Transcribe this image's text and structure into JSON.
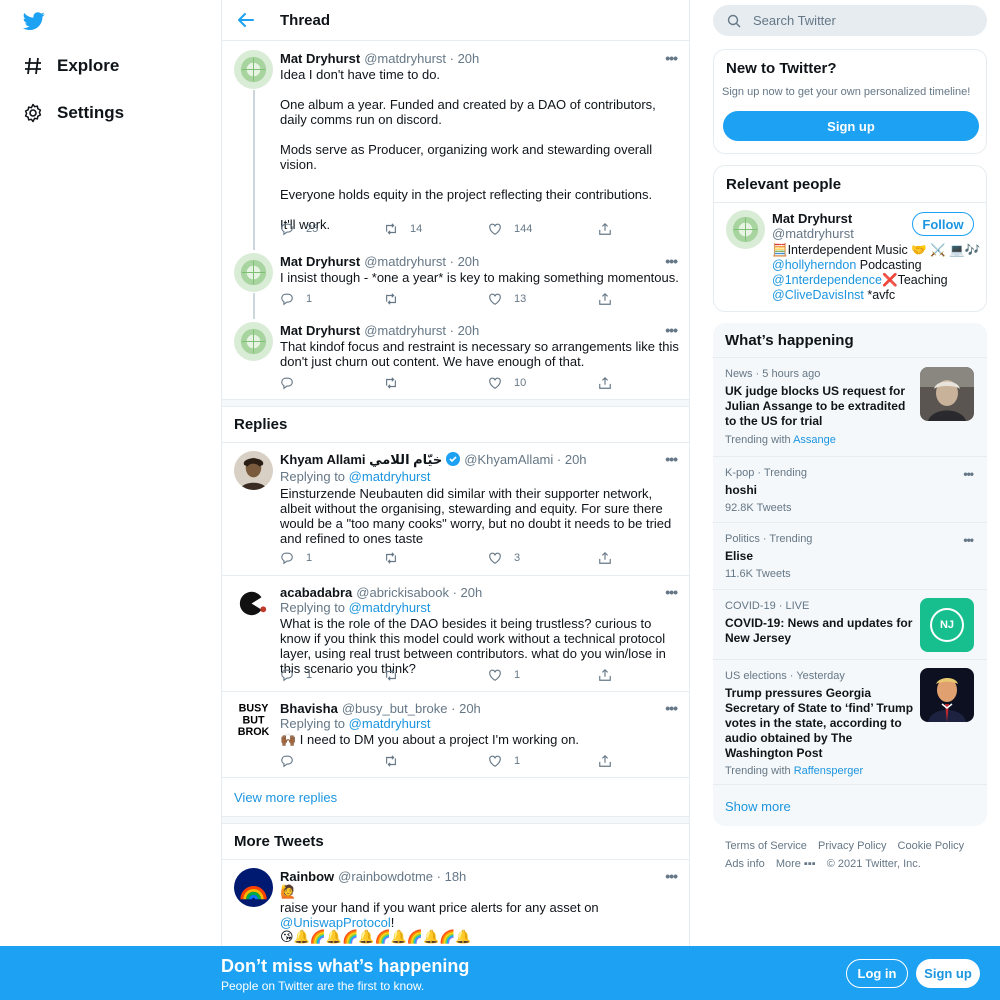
{
  "nav": {
    "explore": "Explore",
    "settings": "Settings"
  },
  "header": {
    "title": "Thread"
  },
  "thread": [
    {
      "name": "Mat Dryhurst",
      "handle": "@matdryhurst",
      "time": "· 20h",
      "paragraphs": [
        "Idea I don't have time to do.",
        "One album a year. Funded and created by a DAO of contributors, daily comms run on discord.",
        "Mods serve as Producer, organizing work and stewarding overall vision.",
        "Everyone holds equity in the project reflecting their contributions.",
        "It'll work."
      ],
      "replies": "25",
      "retweets": "14",
      "likes": "144"
    },
    {
      "name": "Mat Dryhurst",
      "handle": "@matdryhurst",
      "time": "· 20h",
      "text": "I insist though - *one a year* is key to making something momentous.",
      "replies": "1",
      "retweets": "",
      "likes": "13"
    },
    {
      "name": "Mat Dryhurst",
      "handle": "@matdryhurst",
      "time": "· 20h",
      "text": "That kindof focus and restraint is necessary so arrangements like this don't just churn out content. We have enough of that.",
      "replies": "",
      "retweets": "",
      "likes": "10"
    }
  ],
  "replies_section": {
    "title": "Replies",
    "replying_label": "Replying to",
    "replying_handle": "@matdryhurst",
    "items": [
      {
        "name": "Khyam Allami خيّام اللامي",
        "handle": "@KhyamAllami",
        "time": "· 20h",
        "text": "Einsturzende Neubauten did similar with their supporter network, albeit without the organising, stewarding and equity. For sure there would be a \"too many cooks\" worry, but no doubt it needs to be tried and refined to ones taste",
        "replies": "1",
        "retweets": "",
        "likes": "3"
      },
      {
        "name": "acabadabra",
        "handle": "@abrickisabook",
        "time": "· 20h",
        "text": "What is the role of the DAO besides it being trustless? curious to know if you think this model could work without a technical protocol layer, using real trust between contributors. what do you win/lose in this scenario you think?",
        "replies": "1",
        "retweets": "",
        "likes": "1"
      },
      {
        "name": "Bhavisha",
        "handle": "@busy_but_broke",
        "time": "· 20h",
        "text": "🙌🏾 I need to DM you about a project I'm working on.",
        "replies": "",
        "retweets": "",
        "likes": "1"
      }
    ],
    "view_more": "View more replies"
  },
  "more_tweets": {
    "title": "More Tweets",
    "tweet": {
      "name": "Rainbow",
      "handle": "@rainbowdotme",
      "time": "· 18h",
      "emoji_line": "🙋",
      "text_prefix": "raise your hand if you want price alerts for any asset on ",
      "mention": "@UniswapProtocol",
      "text_suffix": "!",
      "emoji_row": "😘🔔🌈🔔🌈🔔🌈🔔🌈🔔🌈🔔"
    }
  },
  "search": {
    "placeholder": "Search Twitter"
  },
  "new_to_twitter": {
    "title": "New to Twitter?",
    "subtitle": "Sign up now to get your own personalized timeline!",
    "button": "Sign up"
  },
  "relevant_people": {
    "title": "Relevant people",
    "name": "Mat Dryhurst",
    "handle": "@matdryhurst",
    "follow": "Follow",
    "bio_line1": "🧮Interdependent Music 🤝 ⚔️ 💻🎶",
    "bio_mention1": "@hollyherndon",
    "bio_after1": " Podcasting",
    "bio_mention2": "@1nterdependence",
    "bio_after2": "❌Teaching",
    "bio_mention3": "@CliveDavisInst",
    "bio_after3": " *avfc"
  },
  "whats_happening": {
    "title": "What’s happening",
    "trends": [
      {
        "category": "News · 5 hours ago",
        "name": "UK judge blocks US request for Julian Assange to be extradited to the US for trial",
        "sub_prefix": "Trending with ",
        "sub_link": "Assange"
      },
      {
        "category": "K-pop · Trending",
        "name": "hoshi",
        "sub": "92.8K Tweets"
      },
      {
        "category": "Politics · Trending",
        "name": "Elise",
        "sub": "11.6K Tweets"
      },
      {
        "category": "COVID-19 · LIVE",
        "name": "COVID-19: News and updates for New Jersey",
        "thumb_text": "NJ"
      },
      {
        "category": "US elections · Yesterday",
        "name": "Trump pressures Georgia Secretary of State to ‘find’ Trump votes in the state, according to audio obtained by The Washington Post",
        "sub_prefix": "Trending with ",
        "sub_link": "Raffensperger"
      }
    ],
    "show_more": "Show more"
  },
  "footer": {
    "terms": "Terms of Service",
    "privacy": "Privacy Policy",
    "cookie": "Cookie Policy",
    "ads": "Ads info",
    "more": "More ▪▪▪",
    "copyright": "© 2021 Twitter, Inc."
  },
  "banner": {
    "headline": "Don’t miss what’s happening",
    "sub": "People on Twitter are the first to know.",
    "login": "Log in",
    "signup": "Sign up"
  },
  "colors": {
    "accent": "#1da1f2",
    "link": "#1b95e0",
    "muted": "#657786",
    "border": "#e6ecf0"
  }
}
